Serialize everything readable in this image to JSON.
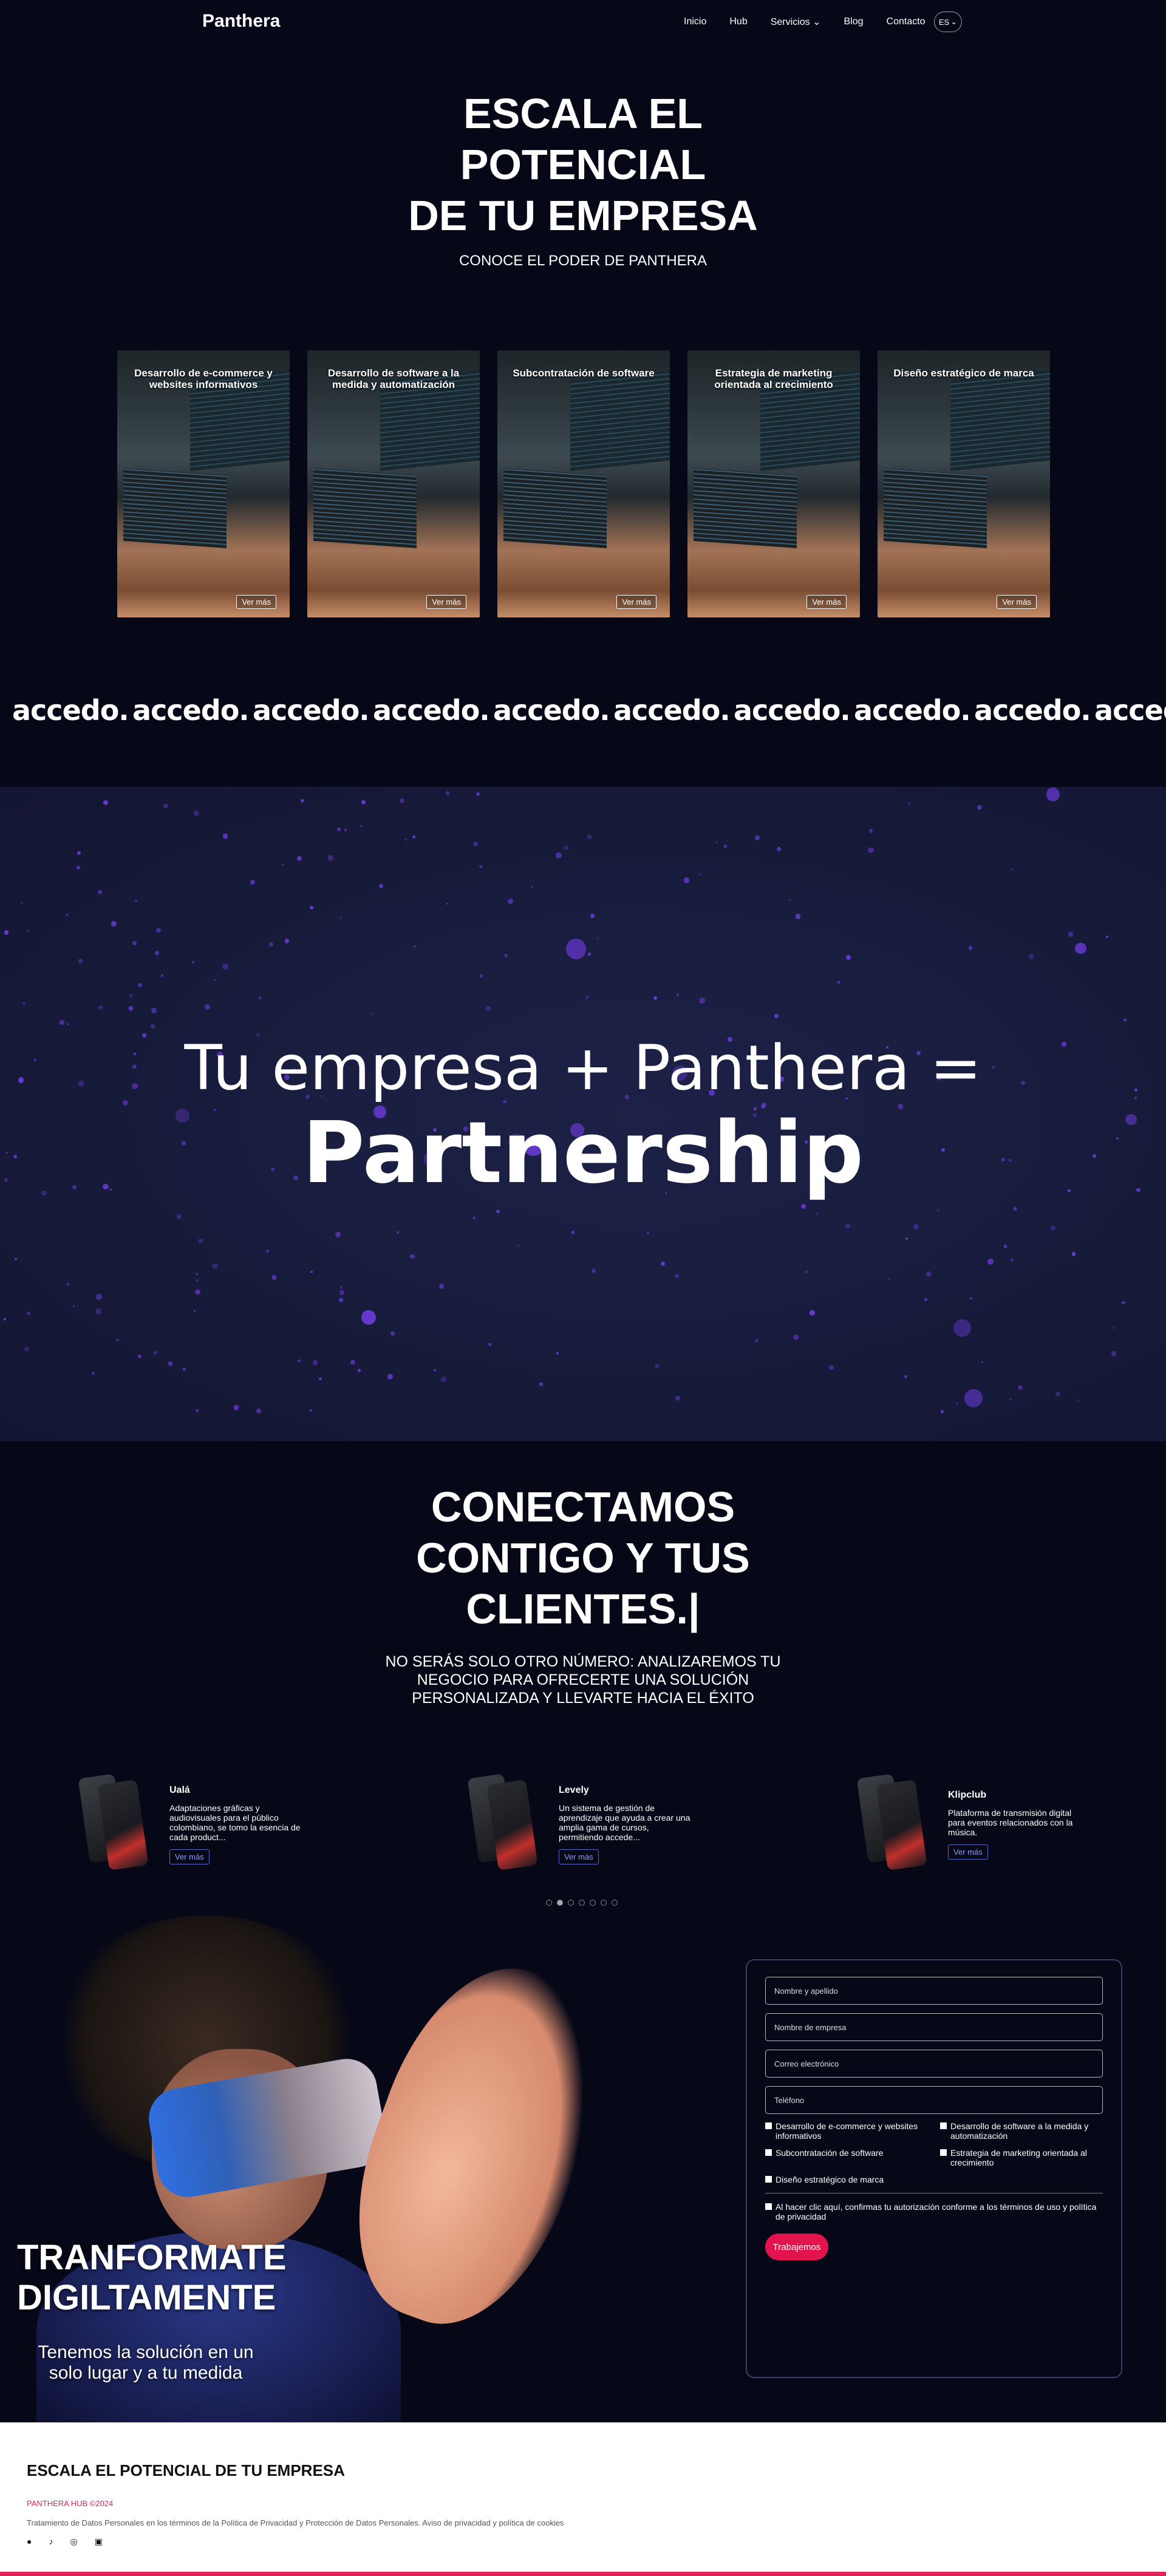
{
  "nav": {
    "logo": "Panthera",
    "items": [
      "Inicio",
      "Hub",
      "Servicios",
      "Blog",
      "Contacto"
    ],
    "lang": "ES"
  },
  "hero": {
    "title": "ESCALA EL POTENCIAL DE TU EMPRESA",
    "title_lines": [
      "ESCALA EL",
      "POTENCIAL",
      "DE TU EMPRESA"
    ],
    "subtitle": "CONOCE EL PODER DE PANTHERA"
  },
  "services": {
    "items": [
      {
        "title": "Desarrollo de e-commerce y websites informativos",
        "button": "Ver más"
      },
      {
        "title": "Desarrollo de software a la medida y automatización",
        "button": "Ver más"
      },
      {
        "title": "Subcontratación de software",
        "button": "Ver más"
      },
      {
        "title": "Estrategia de marketing orientada al crecimiento",
        "button": "Ver más"
      },
      {
        "title": "Diseño estratégico de marca",
        "button": "Ver más"
      }
    ]
  },
  "clients": {
    "logos": [
      "accedo.",
      "accedo.",
      "accedo.",
      "accedo.",
      "accedo.",
      "accedo.",
      "accedo.",
      "accedo.",
      "accedo.",
      "accedo."
    ]
  },
  "partnership": {
    "line1": "Tu empresa + Panthera =",
    "line2": "Partnership",
    "accent": "#6b3ad8"
  },
  "connect": {
    "title_lines": [
      "CONECTAMOS",
      "CONTIGO Y TUS",
      "CLIENTES.|"
    ],
    "subtitle": "NO SERÁS SOLO OTRO NÚMERO: ANALIZAREMOS TU NEGOCIO PARA OFRECERTE UNA SOLUCIÓN PERSONALIZADA Y LLEVARTE HACIA EL ÉXITO"
  },
  "projects": {
    "items": [
      {
        "name": "Ualá",
        "desc": "Adaptaciones gráficas y audiovisuales para el público colombiano, se tomo la esencia de cada product...",
        "button": "Ver más"
      },
      {
        "name": "Levely",
        "desc": "Un sistema de gestión de aprendizaje que ayuda a crear una amplia gama de cursos, permitiendo accede...",
        "button": "Ver más"
      },
      {
        "name": "Klipclub",
        "desc": "Plataforma de transmisión digital para eventos relacionados con la música.",
        "button": "Ver más"
      }
    ],
    "dots": 7,
    "active_dot": 1
  },
  "vr": {
    "title_lines": [
      "TRANFORMATE",
      "DIGILTAMENTE"
    ],
    "subtitle": "Tenemos la solución en un solo lugar y a tu medida"
  },
  "form": {
    "fields": [
      "Nombre y apellido",
      "Nombre de empresa",
      "Correo electrónico",
      "Teléfono"
    ],
    "options": [
      "Desarrollo de e-commerce y websites informativos",
      "Desarrollo de software a la medida y automatización",
      "Subcontratación de software",
      "Estrategia de marketing orientada al crecimiento",
      "Diseño estratégico de marca"
    ],
    "consent": "Al hacer clic aquí, confirmas tu autorización conforme a los términos de uso y política de privacidad",
    "submit": "Trabajemos",
    "accent": "#e3134d"
  },
  "footer": {
    "title": "ESCALA EL POTENCIAL DE TU EMPRESA",
    "copyright": "PANTHERA HUB ©2024",
    "legal": "Tratamiento de Datos Personales en los términos de la Política de Privacidad y Protección de Datos Personales. Aviso de privacidad y política de cookies",
    "icons": [
      "facebook-icon",
      "tiktok-icon",
      "instagram-icon",
      "linkedin-icon"
    ],
    "accent": "#e0245e"
  }
}
